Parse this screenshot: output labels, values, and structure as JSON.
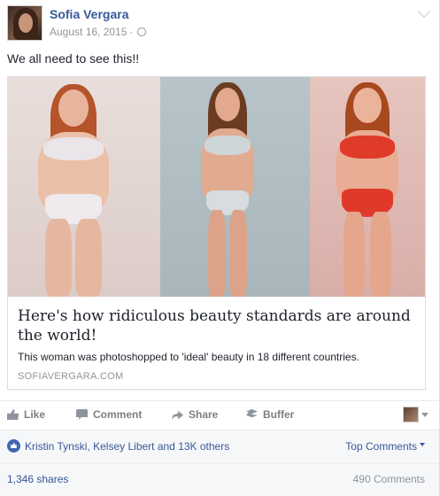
{
  "post": {
    "author": "Sofia Vergara",
    "date": "August 16, 2015",
    "separator": "·",
    "text": "We all need to see this!!"
  },
  "link_preview": {
    "title": "Here's how ridiculous beauty standards are around the world!",
    "description": "This woman was photoshopped to 'ideal' beauty in 18 different countries.",
    "domain": "SOFIAVERGARA.COM"
  },
  "actions": {
    "like": "Like",
    "comment": "Comment",
    "share": "Share",
    "buffer": "Buffer"
  },
  "reactions": {
    "likers": "Kristin Tynski, Kelsey Libert and 13K others",
    "sort": "Top Comments"
  },
  "stats": {
    "shares": "1,346 shares",
    "comments": "490 Comments"
  },
  "icons": [
    "like-icon",
    "comment-icon",
    "share-icon",
    "buffer-icon",
    "globe-icon",
    "chevron-down-icon"
  ],
  "colors": {
    "link_blue": "#365899",
    "muted_gray": "#90949c",
    "like_badge": "#4267b2",
    "panel_bg": "#f6f7f9"
  }
}
